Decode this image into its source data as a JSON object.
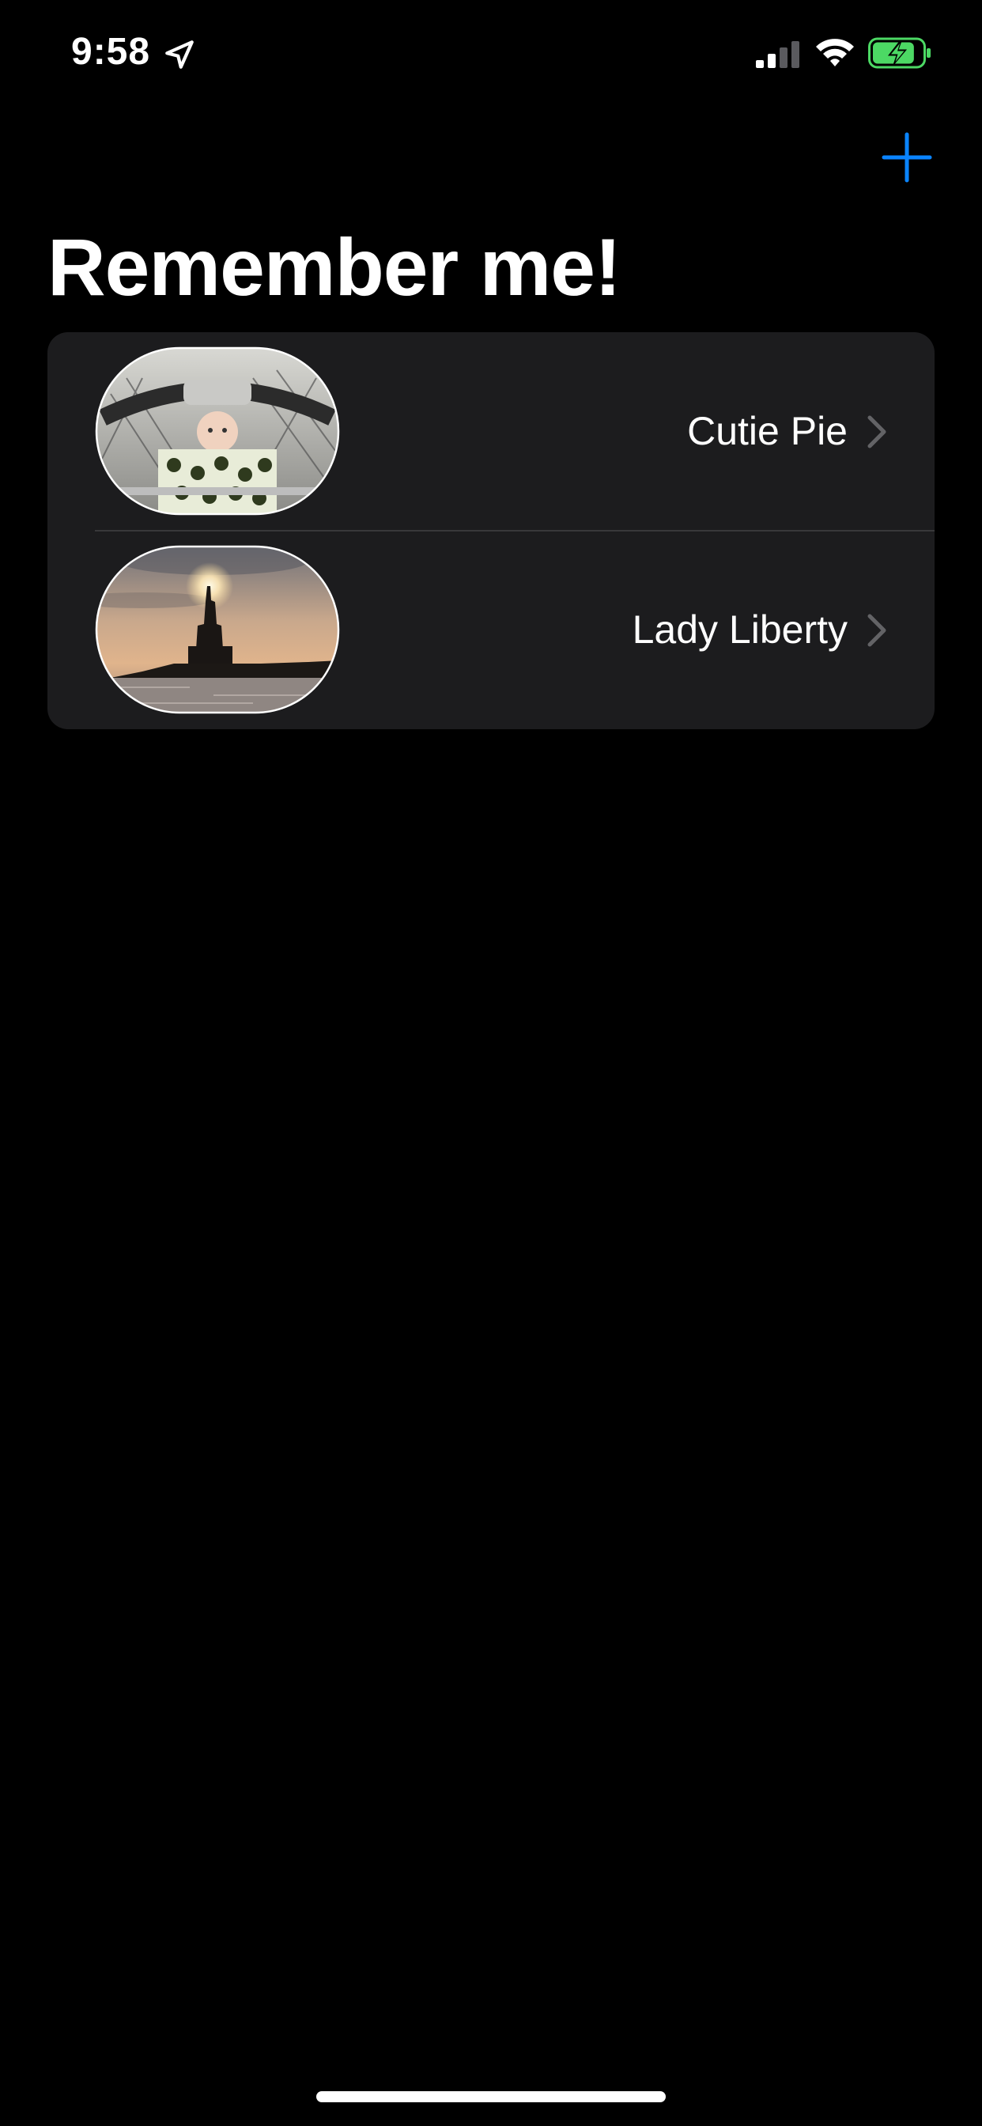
{
  "status_bar": {
    "time": "9:58",
    "location_icon": "location-arrow-icon",
    "signal_icon": "cellular-signal-icon",
    "wifi_icon": "wifi-icon",
    "battery_icon": "battery-charging-icon",
    "signal_level": 0.5,
    "battery_level": 0.85,
    "battery_color": "#4cd964"
  },
  "nav": {
    "add_icon": "plus-icon",
    "accent_color": "#0a84ff"
  },
  "title": "Remember me!",
  "items": [
    {
      "name": "Cutie Pie",
      "thumbnail": "baby-in-car-seat-photo"
    },
    {
      "name": "Lady Liberty",
      "thumbnail": "statue-of-liberty-sunset-photo"
    }
  ],
  "colors": {
    "background": "#000000",
    "card": "#1c1c1e",
    "text": "#ffffff",
    "chevron": "#636366"
  }
}
